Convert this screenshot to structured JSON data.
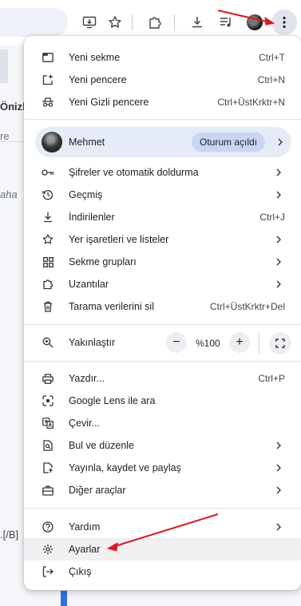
{
  "background": {
    "fragments": [
      "Önizle",
      "re",
      "aha",
      ".[/B]"
    ]
  },
  "toolbar": {
    "icons": [
      "install-app-icon",
      "bookmark-star-icon",
      "extensions-icon",
      "downloads-icon",
      "media-queue-icon",
      "profile-avatar",
      "more-menu-icon"
    ]
  },
  "menu": {
    "top_items": [
      {
        "label": "Yeni sekme",
        "shortcut": "Ctrl+T",
        "icon": "new-tab-icon"
      },
      {
        "label": "Yeni pencere",
        "shortcut": "Ctrl+N",
        "icon": "new-window-icon"
      },
      {
        "label": "Yeni Gizli pencere",
        "shortcut": "Ctrl+ÜstKrktr+N",
        "icon": "incognito-icon"
      }
    ],
    "profile": {
      "name": "Mehmet",
      "status": "Oturum açıldı"
    },
    "mid_items": [
      {
        "label": "Şifreler ve otomatik doldurma",
        "shortcut": "",
        "icon": "key-icon",
        "submenu": true
      },
      {
        "label": "Geçmiş",
        "shortcut": "",
        "icon": "history-icon",
        "submenu": true
      },
      {
        "label": "İndirilenler",
        "shortcut": "Ctrl+J",
        "icon": "download-icon",
        "submenu": false
      },
      {
        "label": "Yer işaretleri ve listeler",
        "shortcut": "",
        "icon": "star-icon",
        "submenu": true
      },
      {
        "label": "Sekme grupları",
        "shortcut": "",
        "icon": "tab-groups-icon",
        "submenu": true
      },
      {
        "label": "Uzantılar",
        "shortcut": "",
        "icon": "extension-icon",
        "submenu": true
      },
      {
        "label": "Tarama verilerini sil",
        "shortcut": "Ctrl+ÜstKrktr+Del",
        "icon": "trash-icon",
        "submenu": false
      }
    ],
    "zoom": {
      "label": "Yakınlaştır",
      "value": "%100",
      "minus": "−",
      "plus": "+"
    },
    "tools_items": [
      {
        "label": "Yazdır...",
        "shortcut": "Ctrl+P",
        "icon": "print-icon",
        "submenu": false
      },
      {
        "label": "Google Lens ile ara",
        "shortcut": "",
        "icon": "lens-icon",
        "submenu": false
      },
      {
        "label": "Çevir...",
        "shortcut": "",
        "icon": "translate-icon",
        "submenu": false
      },
      {
        "label": "Bul ve düzenle",
        "shortcut": "",
        "icon": "find-icon",
        "submenu": true
      },
      {
        "label": "Yayınla, kaydet ve paylaş",
        "shortcut": "",
        "icon": "cast-save-share-icon",
        "submenu": true
      },
      {
        "label": "Diğer araçlar",
        "shortcut": "",
        "icon": "toolbox-icon",
        "submenu": true
      }
    ],
    "bottom_items": [
      {
        "label": "Yardım",
        "shortcut": "",
        "icon": "help-icon",
        "submenu": true
      },
      {
        "label": "Ayarlar",
        "shortcut": "",
        "icon": "settings-gear-icon",
        "submenu": false
      },
      {
        "label": "Çıkış",
        "shortcut": "",
        "icon": "exit-icon",
        "submenu": false
      }
    ]
  },
  "annotations": {
    "arrow_color": "#e3161c"
  },
  "colors": {
    "menu_bg": "#ffffff",
    "profile_bg": "#e5ebf7",
    "badge_bg": "#c9d6f2",
    "accent_blue": "#2f6fe8"
  }
}
